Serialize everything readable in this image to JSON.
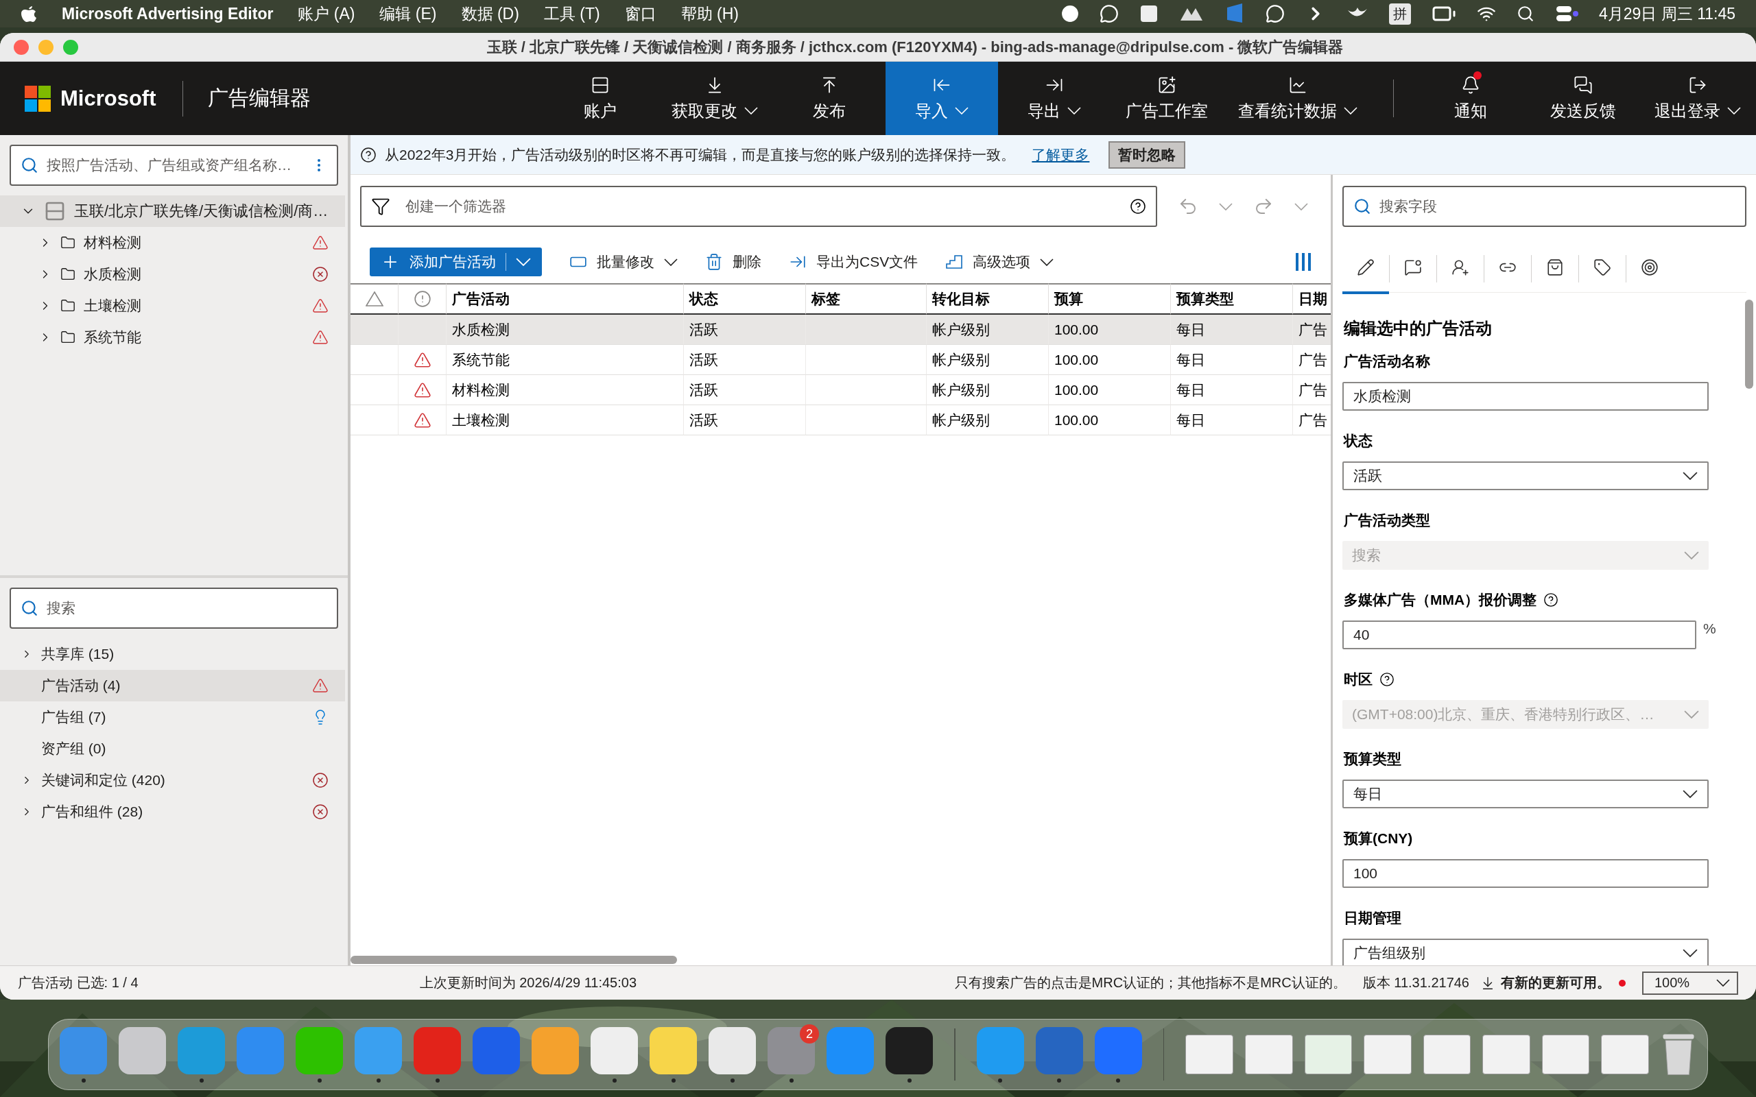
{
  "menu_bar": {
    "app_name": "Microsoft Advertising Editor",
    "menus": [
      "账户 (A)",
      "编辑 (E)",
      "数据 (D)",
      "工具 (T)",
      "窗口",
      "帮助 (H)"
    ],
    "input_method": "拼",
    "clock": "4月29日 周三  11:45"
  },
  "window": {
    "title": "玉联 / 北京广联先锋 / 天衡诚信检测 / 商务服务 / jcthcx.com (F120YXM4) - bing-ads-manage@dripulse.com - 微软广告编辑器"
  },
  "header": {
    "brand": "Microsoft",
    "product": "广告编辑器",
    "nav": [
      {
        "label": "账户",
        "kind": "account",
        "dropdown": false,
        "selected": false
      },
      {
        "label": "获取更改",
        "kind": "download",
        "dropdown": true,
        "selected": false
      },
      {
        "label": "发布",
        "kind": "publish",
        "dropdown": false,
        "selected": false
      },
      {
        "label": "导入",
        "kind": "import",
        "dropdown": true,
        "selected": true
      },
      {
        "label": "导出",
        "kind": "export",
        "dropdown": true,
        "selected": false
      },
      {
        "label": "广告工作室",
        "kind": "studio",
        "dropdown": false,
        "selected": false
      },
      {
        "label": "查看统计数据",
        "kind": "stats",
        "dropdown": true,
        "selected": false
      }
    ],
    "right_nav": [
      {
        "label": "通知",
        "kind": "bell",
        "dropdown": false,
        "badge": true
      },
      {
        "label": "发送反馈",
        "kind": "feedback",
        "dropdown": false,
        "badge": false
      },
      {
        "label": "退出登录",
        "kind": "signout",
        "dropdown": true,
        "badge": false
      }
    ]
  },
  "notice": {
    "text": "从2022年3月开始，广告活动级别的时区将不再可编辑，而是直接与您的账户级别的选择保持一致。",
    "link": "了解更多",
    "button": "暂时忽略"
  },
  "sidebar": {
    "search": {
      "placeholder": "按照广告活动、广告组或资产组名称…"
    },
    "tree": {
      "label": "玉联/北京广联先锋/天衡诚信检测/商…",
      "expanded": true,
      "selected": true,
      "children": [
        {
          "label": "材料检测",
          "kind": "warning",
          "expanded": false
        },
        {
          "label": "水质检测",
          "kind": "error",
          "expanded": false
        },
        {
          "label": "土壤检测",
          "kind": "warning",
          "expanded": false
        },
        {
          "label": "系统节能",
          "kind": "warning",
          "expanded": false
        }
      ]
    }
  },
  "library": {
    "search": {
      "placeholder": "搜索"
    },
    "items": [
      {
        "label": "共享库 (15)",
        "expandable": true,
        "selected": false,
        "kind": "plain"
      },
      {
        "label": "广告活动 (4)",
        "expandable": false,
        "selected": true,
        "kind": "warning"
      },
      {
        "label": "广告组 (7)",
        "expandable": false,
        "selected": false,
        "kind": "hint"
      },
      {
        "label": "资产组 (0)",
        "expandable": false,
        "selected": false,
        "kind": "plain"
      },
      {
        "label": "关键词和定位 (420)",
        "expandable": true,
        "selected": false,
        "kind": "error"
      },
      {
        "label": "广告和组件 (28)",
        "expandable": true,
        "selected": false,
        "kind": "error"
      }
    ]
  },
  "filter": {
    "placeholder": "创建一个筛选器"
  },
  "toolbar": {
    "add_button": "添加广告活动",
    "actions": [
      {
        "label": "批量修改",
        "kind": "bulk",
        "dropdown": true
      },
      {
        "label": "删除",
        "kind": "delete",
        "dropdown": false
      },
      {
        "label": "导出为CSV文件",
        "kind": "export",
        "dropdown": false
      },
      {
        "label": "高级选项",
        "kind": "advanced",
        "dropdown": true
      }
    ]
  },
  "table": {
    "columns": [
      "广告活动",
      "状态",
      "标签",
      "转化目标",
      "预算",
      "预算类型",
      "日期"
    ],
    "rows": [
      {
        "selected": true,
        "warning": false,
        "cells": [
          "水质检测",
          "活跃",
          "",
          "帐户级别",
          "100.00",
          "每日",
          "广告"
        ]
      },
      {
        "selected": false,
        "warning": true,
        "cells": [
          "系统节能",
          "活跃",
          "",
          "帐户级别",
          "100.00",
          "每日",
          "广告"
        ]
      },
      {
        "selected": false,
        "warning": true,
        "cells": [
          "材料检测",
          "活跃",
          "",
          "帐户级别",
          "100.00",
          "每日",
          "广告"
        ]
      },
      {
        "selected": false,
        "warning": true,
        "cells": [
          "土壤检测",
          "活跃",
          "",
          "帐户级别",
          "100.00",
          "每日",
          "广告"
        ]
      }
    ]
  },
  "editor": {
    "search": {
      "placeholder": "搜索字段"
    },
    "tabs": [
      {
        "kind": "edit",
        "selected": true
      },
      {
        "kind": "preview",
        "selected": false
      },
      {
        "kind": "assist",
        "selected": false
      },
      {
        "kind": "link",
        "selected": false
      },
      {
        "kind": "bag",
        "selected": false
      },
      {
        "kind": "tag",
        "selected": false
      },
      {
        "kind": "target",
        "selected": false
      }
    ],
    "heading": "编辑选中的广告活动",
    "fields": [
      {
        "label": "广告活动名称",
        "kind": "text",
        "value": "水质检测",
        "help": false
      },
      {
        "label": "状态",
        "kind": "select",
        "value": "活跃",
        "disabled": false,
        "help": false
      },
      {
        "label": "广告活动类型",
        "kind": "select",
        "value": "搜索",
        "disabled": true,
        "help": false
      },
      {
        "label": "多媒体广告（MMA）报价调整",
        "kind": "text",
        "value": "40",
        "help": true,
        "suffix": "%"
      },
      {
        "label": "时区",
        "kind": "select",
        "value": "(GMT+08:00)北京、重庆、香港特别行政区、…",
        "disabled": true,
        "help": true
      },
      {
        "label": "预算类型",
        "kind": "select",
        "value": "每日",
        "disabled": false,
        "help": false
      },
      {
        "label": "预算(CNY)",
        "kind": "text",
        "value": "100",
        "help": false
      },
      {
        "label": "日期管理",
        "kind": "select",
        "value": "广告组级别",
        "disabled": false,
        "help": false
      }
    ]
  },
  "status_bar": {
    "selection": "广告活动 已选: 1 / 4",
    "last_updated": "上次更新时间为 2026/4/29 11:45:03",
    "mrc_note": "只有搜索广告的点击是MRC认证的；其他指标不是MRC认证的。",
    "version": "版本 11.31.21746",
    "update": "有新的更新可用。",
    "zoom": "100%"
  },
  "dock": {
    "apps": [
      {
        "kind": "app",
        "color": "#3b8fe6",
        "running": true
      },
      {
        "kind": "app",
        "color": "#c9c9cc",
        "running": false
      },
      {
        "kind": "app",
        "color": "#1d9bd8",
        "running": true
      },
      {
        "kind": "app",
        "color": "#2f8cf0",
        "running": false
      },
      {
        "kind": "app",
        "color": "#2dc100",
        "running": true
      },
      {
        "kind": "app",
        "color": "#3aa0f0",
        "running": true
      },
      {
        "kind": "app",
        "color": "#e2231a",
        "running": true
      },
      {
        "kind": "app",
        "color": "#1e5fe8",
        "running": false
      },
      {
        "kind": "app",
        "color": "#f4a12d",
        "running": false
      },
      {
        "kind": "app",
        "color": "#eeeeee",
        "running": true
      },
      {
        "kind": "app",
        "color": "#f7d549",
        "running": true
      },
      {
        "kind": "app",
        "color": "#e9e9e9",
        "running": true
      },
      {
        "kind": "app",
        "color": "#8e8e93",
        "running": true,
        "badge": "2"
      },
      {
        "kind": "app",
        "color": "#1c8ef9",
        "running": false
      },
      {
        "kind": "app",
        "color": "#1e1e1e",
        "running": true
      },
      {
        "kind": "separator"
      },
      {
        "kind": "app",
        "color": "#1f9bf0",
        "running": true
      },
      {
        "kind": "app",
        "color": "#2665c0",
        "running": true
      },
      {
        "kind": "app",
        "color": "#1f6dff",
        "running": true
      },
      {
        "kind": "separator"
      },
      {
        "kind": "window",
        "color": "#f2f2f2"
      },
      {
        "kind": "window",
        "color": "#f2f2f2"
      },
      {
        "kind": "window",
        "color": "#e6f2e6"
      },
      {
        "kind": "window",
        "color": "#f2f2f2"
      },
      {
        "kind": "window",
        "color": "#f2f2f2"
      },
      {
        "kind": "window",
        "color": "#f2f2f2"
      },
      {
        "kind": "window",
        "color": "#f2f2f2"
      },
      {
        "kind": "window",
        "color": "#f2f2f2"
      },
      {
        "kind": "trash",
        "color": "#d8d8d8"
      }
    ]
  }
}
